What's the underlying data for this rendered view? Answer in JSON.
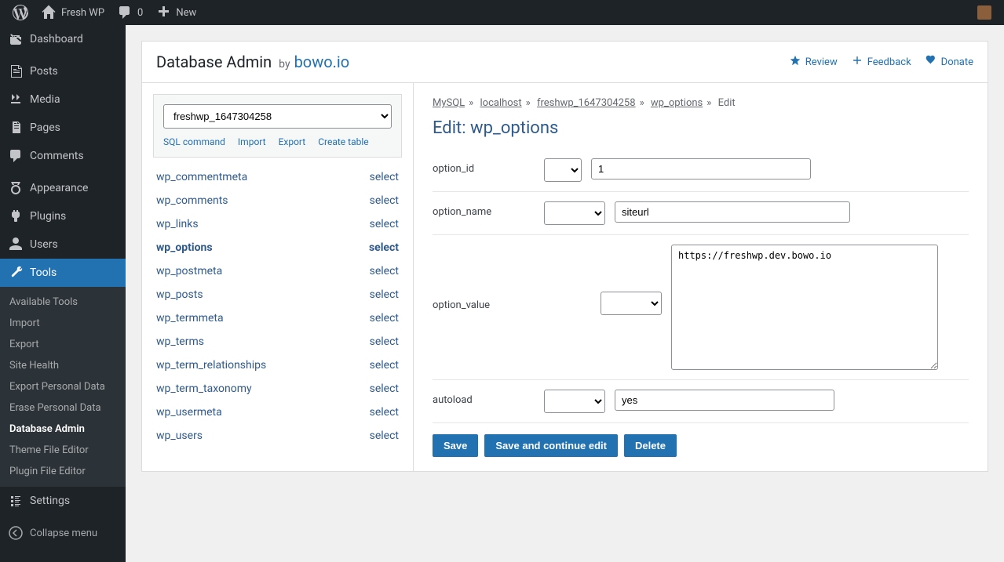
{
  "toolbar": {
    "site_name": "Fresh WP",
    "comment_count": "0",
    "new_label": "New"
  },
  "sidebar": {
    "items": [
      {
        "name": "dashboard",
        "label": "Dashboard"
      },
      {
        "name": "posts",
        "label": "Posts"
      },
      {
        "name": "media",
        "label": "Media"
      },
      {
        "name": "pages",
        "label": "Pages"
      },
      {
        "name": "comments",
        "label": "Comments"
      },
      {
        "name": "appearance",
        "label": "Appearance"
      },
      {
        "name": "plugins",
        "label": "Plugins"
      },
      {
        "name": "users",
        "label": "Users"
      },
      {
        "name": "tools",
        "label": "Tools"
      },
      {
        "name": "settings",
        "label": "Settings"
      }
    ],
    "tools_sub": [
      {
        "label": "Available Tools",
        "active": false
      },
      {
        "label": "Import",
        "active": false
      },
      {
        "label": "Export",
        "active": false
      },
      {
        "label": "Site Health",
        "active": false
      },
      {
        "label": "Export Personal Data",
        "active": false
      },
      {
        "label": "Erase Personal Data",
        "active": false
      },
      {
        "label": "Database Admin",
        "active": true
      },
      {
        "label": "Theme File Editor",
        "active": false
      },
      {
        "label": "Plugin File Editor",
        "active": false
      }
    ],
    "collapse_label": "Collapse menu"
  },
  "header": {
    "title": "Database Admin",
    "by": "by",
    "author": "bowo.io",
    "links": {
      "review": "Review",
      "feedback": "Feedback",
      "donate": "Donate"
    }
  },
  "dbpanel": {
    "selected_db": "freshwp_1647304258",
    "actions": {
      "sql": "SQL command",
      "import": "Import",
      "export": "Export",
      "create": "Create table"
    },
    "tables": [
      {
        "name": "wp_commentmeta",
        "active": false
      },
      {
        "name": "wp_comments",
        "active": false
      },
      {
        "name": "wp_links",
        "active": false
      },
      {
        "name": "wp_options",
        "active": true
      },
      {
        "name": "wp_postmeta",
        "active": false
      },
      {
        "name": "wp_posts",
        "active": false
      },
      {
        "name": "wp_termmeta",
        "active": false
      },
      {
        "name": "wp_terms",
        "active": false
      },
      {
        "name": "wp_term_relationships",
        "active": false
      },
      {
        "name": "wp_term_taxonomy",
        "active": false
      },
      {
        "name": "wp_usermeta",
        "active": false
      },
      {
        "name": "wp_users",
        "active": false
      }
    ],
    "select_label": "select"
  },
  "breadcrumbs": {
    "mysql": "MySQL",
    "host": "localhost",
    "db": "freshwp_1647304258",
    "table": "wp_options",
    "action": "Edit"
  },
  "content": {
    "heading": "Edit: wp_options",
    "fields": {
      "option_id": {
        "label": "option_id",
        "value": "1"
      },
      "option_name": {
        "label": "option_name",
        "value": "siteurl"
      },
      "option_value": {
        "label": "option_value",
        "value": "https://freshwp.dev.bowo.io"
      },
      "autoload": {
        "label": "autoload",
        "value": "yes"
      }
    },
    "buttons": {
      "save": "Save",
      "save_continue": "Save and continue edit",
      "delete": "Delete"
    }
  }
}
